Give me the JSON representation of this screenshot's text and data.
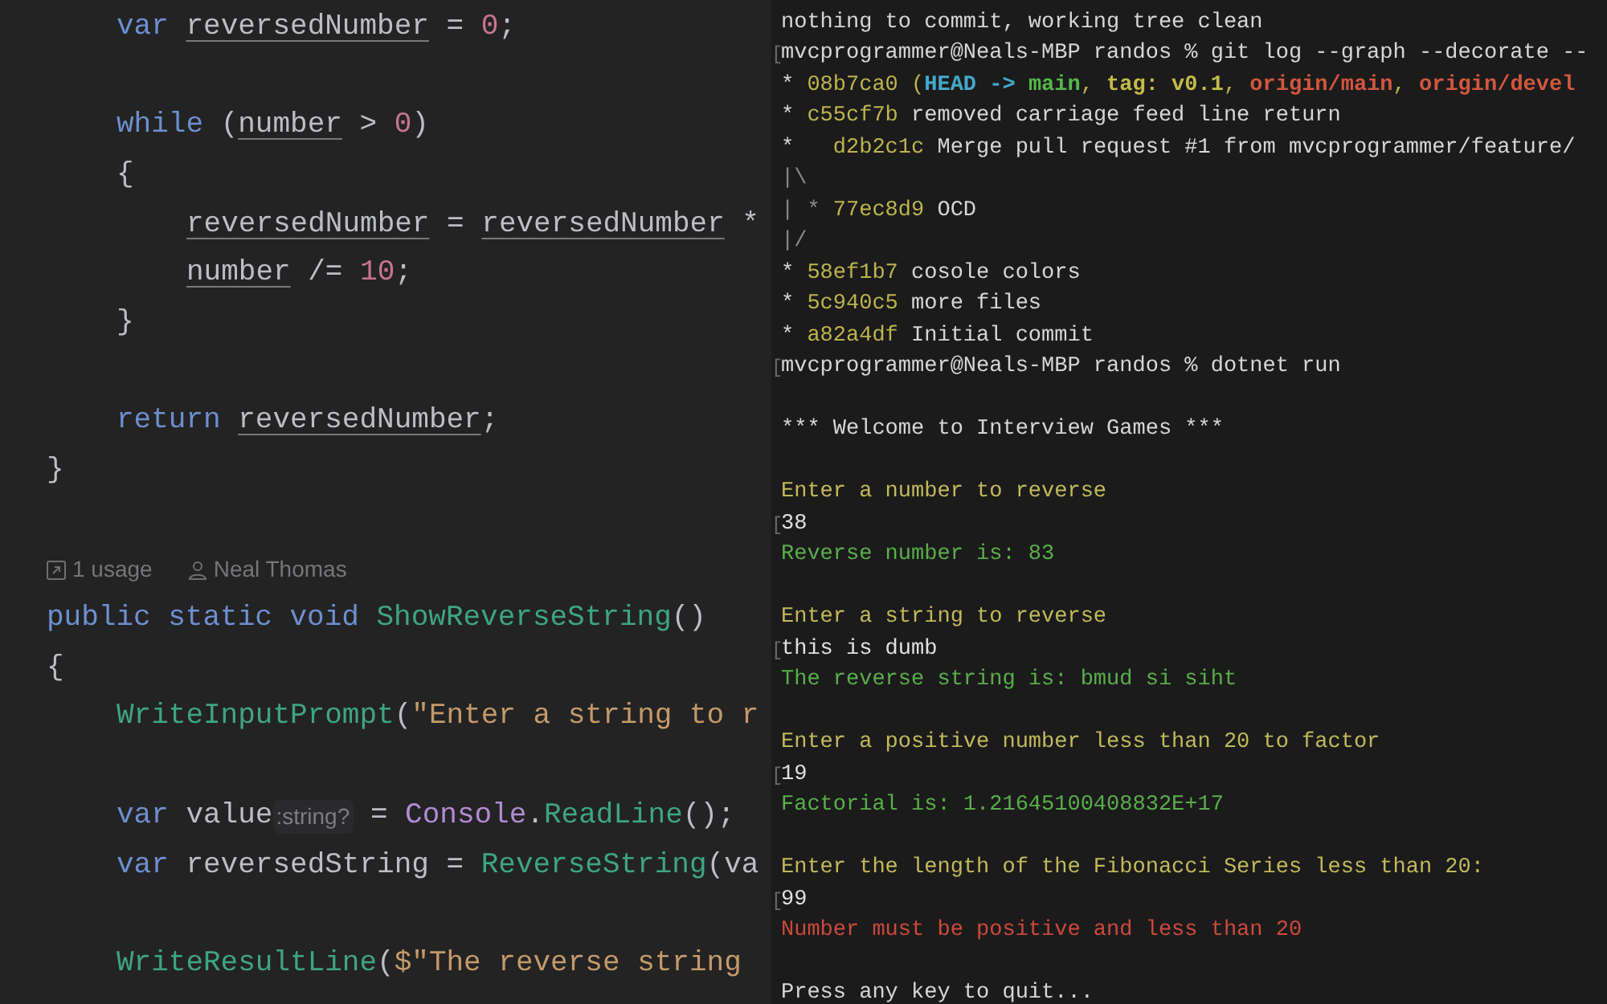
{
  "editor": {
    "lines": [
      {
        "kind": "group",
        "children": [
          {
            "kind": "code",
            "tokens": [
              {
                "kind": "keyword",
                "text": "var "
              },
              {
                "kind": "local",
                "text": "reversedNumber"
              },
              {
                "kind": "plain",
                "text": " = "
              },
              {
                "kind": "number",
                "text": "0"
              },
              {
                "kind": "plain",
                "text": ";"
              }
            ]
          },
          {
            "kind": "blank"
          },
          {
            "kind": "code",
            "tokens": [
              {
                "kind": "keyword",
                "text": "while"
              },
              {
                "kind": "plain",
                "text": " ("
              },
              {
                "kind": "local",
                "text": "number"
              },
              {
                "kind": "plain",
                "text": " > "
              },
              {
                "kind": "number",
                "text": "0"
              },
              {
                "kind": "plain",
                "text": ")"
              }
            ]
          },
          {
            "kind": "code",
            "tokens": [
              {
                "kind": "plain",
                "text": "{"
              }
            ],
            "children": [
              {
                "kind": "code",
                "tokens": [
                  {
                    "kind": "local",
                    "text": "reversedNumber"
                  },
                  {
                    "kind": "plain",
                    "text": " = "
                  },
                  {
                    "kind": "local",
                    "text": "reversedNumber"
                  },
                  {
                    "kind": "plain",
                    "text": " *"
                  }
                ]
              },
              {
                "kind": "code",
                "tokens": [
                  {
                    "kind": "local",
                    "text": "number"
                  },
                  {
                    "kind": "plain",
                    "text": " /= "
                  },
                  {
                    "kind": "number",
                    "text": "10"
                  },
                  {
                    "kind": "plain",
                    "text": ";"
                  }
                ]
              }
            ]
          },
          {
            "kind": "code",
            "tokens": [
              {
                "kind": "plain",
                "text": "}"
              }
            ]
          },
          {
            "kind": "blank"
          },
          {
            "kind": "code",
            "tokens": [
              {
                "kind": "keyword",
                "text": "return "
              },
              {
                "kind": "local",
                "text": "reversedNumber"
              },
              {
                "kind": "plain",
                "text": ";"
              }
            ]
          }
        ]
      },
      {
        "kind": "code",
        "tokens": [
          {
            "kind": "plain",
            "text": "}"
          }
        ]
      },
      {
        "kind": "blank"
      },
      {
        "kind": "lens",
        "usages": "1 usage",
        "author": "Neal Thomas"
      },
      {
        "kind": "code",
        "tokens": [
          {
            "kind": "keyword",
            "text": "public static void "
          },
          {
            "kind": "func",
            "text": "ShowReverseString"
          },
          {
            "kind": "plain",
            "text": "()"
          }
        ]
      },
      {
        "kind": "code",
        "tokens": [
          {
            "kind": "plain",
            "text": "{"
          }
        ],
        "children": [
          {
            "kind": "code",
            "tokens": [
              {
                "kind": "func",
                "text": "WriteInputPrompt"
              },
              {
                "kind": "plain",
                "text": "("
              },
              {
                "kind": "string",
                "text": "\"Enter a string to r"
              }
            ]
          },
          {
            "kind": "blank"
          },
          {
            "kind": "code",
            "tokens": [
              {
                "kind": "keyword",
                "text": "var"
              },
              {
                "kind": "plain",
                "text": " value"
              },
              {
                "kind": "hint",
                "text": ":string?"
              },
              {
                "kind": "plain",
                "text": " = "
              },
              {
                "kind": "class",
                "text": "Console"
              },
              {
                "kind": "plain",
                "text": "."
              },
              {
                "kind": "func",
                "text": "ReadLine"
              },
              {
                "kind": "plain",
                "text": "();"
              }
            ]
          },
          {
            "kind": "code",
            "tokens": [
              {
                "kind": "keyword",
                "text": "var"
              },
              {
                "kind": "plain",
                "text": " reversedString = "
              },
              {
                "kind": "func",
                "text": "ReverseString"
              },
              {
                "kind": "plain",
                "text": "(va"
              }
            ]
          },
          {
            "kind": "blank"
          },
          {
            "kind": "code",
            "tokens": [
              {
                "kind": "func",
                "text": "WriteResultLine"
              },
              {
                "kind": "plain",
                "text": "("
              },
              {
                "kind": "string",
                "text": "$\"The reverse string"
              }
            ]
          }
        ]
      }
    ]
  },
  "terminal": {
    "lines": [
      {
        "kind": "text",
        "segments": [
          {
            "text": "nothing to commit, working tree clean",
            "color": "#d6d6d6"
          }
        ]
      },
      {
        "kind": "text",
        "mark": "[",
        "segments": [
          {
            "text": "mvcprogrammer@Neals-MBP randos % git log --graph --decorate --",
            "color": "#d6d6d6"
          }
        ]
      },
      {
        "kind": "text",
        "segments": [
          {
            "text": "* ",
            "color": "#d6d6d6"
          },
          {
            "text": "08b7ca0 (",
            "color": "#bdb44c"
          },
          {
            "text": "HEAD -> ",
            "color": "#45a8cc",
            "bold": true
          },
          {
            "text": "main",
            "color": "#55b849",
            "bold": true
          },
          {
            "text": ", ",
            "color": "#bdb44c"
          },
          {
            "text": "tag: v0.1",
            "color": "#c6bb4a",
            "bold": true
          },
          {
            "text": ", ",
            "color": "#bdb44c"
          },
          {
            "text": "origin/main",
            "color": "#d2573f",
            "bold": true
          },
          {
            "text": ", ",
            "color": "#bdb44c"
          },
          {
            "text": "origin/devel",
            "color": "#d2573f",
            "bold": true
          }
        ]
      },
      {
        "kind": "text",
        "segments": [
          {
            "text": "* ",
            "color": "#d6d6d6"
          },
          {
            "text": "c55cf7b",
            "color": "#bdb44c"
          },
          {
            "text": " removed carriage feed line return",
            "color": "#d6d6d6"
          }
        ]
      },
      {
        "kind": "text",
        "segments": [
          {
            "text": "*   ",
            "color": "#d6d6d6"
          },
          {
            "text": "d2b2c1c",
            "color": "#bdb44c"
          },
          {
            "text": " Merge pull request #1 from mvcprogrammer/feature/",
            "color": "#d6d6d6"
          }
        ]
      },
      {
        "kind": "text",
        "segments": [
          {
            "text": "|\\",
            "color": "#8a8a8a"
          }
        ]
      },
      {
        "kind": "text",
        "segments": [
          {
            "text": "| * ",
            "color": "#8a8a8a"
          },
          {
            "text": "77ec8d9",
            "color": "#bdb44c"
          },
          {
            "text": " OCD",
            "color": "#d6d6d6"
          }
        ]
      },
      {
        "kind": "text",
        "segments": [
          {
            "text": "|/",
            "color": "#8a8a8a"
          }
        ]
      },
      {
        "kind": "text",
        "segments": [
          {
            "text": "* ",
            "color": "#d6d6d6"
          },
          {
            "text": "58ef1b7",
            "color": "#bdb44c"
          },
          {
            "text": " cosole colors",
            "color": "#d6d6d6"
          }
        ]
      },
      {
        "kind": "text",
        "segments": [
          {
            "text": "* ",
            "color": "#d6d6d6"
          },
          {
            "text": "5c940c5",
            "color": "#bdb44c"
          },
          {
            "text": " more files",
            "color": "#d6d6d6"
          }
        ]
      },
      {
        "kind": "text",
        "segments": [
          {
            "text": "* ",
            "color": "#d6d6d6"
          },
          {
            "text": "a82a4df",
            "color": "#bdb44c"
          },
          {
            "text": " Initial commit",
            "color": "#d6d6d6"
          }
        ]
      },
      {
        "kind": "text",
        "mark": "[",
        "segments": [
          {
            "text": "mvcprogrammer@Neals-MBP randos % dotnet run",
            "color": "#d6d6d6"
          }
        ]
      },
      {
        "kind": "blank"
      },
      {
        "kind": "text",
        "segments": [
          {
            "text": "*** Welcome to Interview Games ***",
            "color": "#d6d6d6"
          }
        ]
      },
      {
        "kind": "blank"
      },
      {
        "kind": "text",
        "segments": [
          {
            "text": "Enter a number to reverse",
            "color": "#c2b95a"
          }
        ]
      },
      {
        "kind": "text",
        "mark": "[",
        "segments": [
          {
            "text": "38",
            "color": "#e0e0e0"
          }
        ]
      },
      {
        "kind": "text",
        "segments": [
          {
            "text": "Reverse number is: 83",
            "color": "#5aae4a"
          }
        ]
      },
      {
        "kind": "blank"
      },
      {
        "kind": "text",
        "segments": [
          {
            "text": "Enter a string to reverse",
            "color": "#c2b95a"
          }
        ]
      },
      {
        "kind": "text",
        "mark": "[",
        "segments": [
          {
            "text": "this is dumb",
            "color": "#e0e0e0"
          }
        ]
      },
      {
        "kind": "text",
        "segments": [
          {
            "text": "The reverse string is: bmud si siht",
            "color": "#5aae4a"
          }
        ]
      },
      {
        "kind": "blank"
      },
      {
        "kind": "text",
        "segments": [
          {
            "text": "Enter a positive number less than 20 to factor",
            "color": "#c2b95a"
          }
        ]
      },
      {
        "kind": "text",
        "mark": "[",
        "segments": [
          {
            "text": "19",
            "color": "#e0e0e0"
          }
        ]
      },
      {
        "kind": "text",
        "segments": [
          {
            "text": "Factorial is: 1.21645100408832E+17",
            "color": "#5aae4a"
          }
        ]
      },
      {
        "kind": "blank"
      },
      {
        "kind": "text",
        "segments": [
          {
            "text": "Enter the length of the Fibonacci Series less than 20:",
            "color": "#c2b95a"
          }
        ]
      },
      {
        "kind": "text",
        "mark": "[",
        "segments": [
          {
            "text": "99",
            "color": "#e0e0e0"
          }
        ]
      },
      {
        "kind": "text",
        "segments": [
          {
            "text": "Number must be positive and less than 20",
            "color": "#cc4a3c"
          }
        ]
      },
      {
        "kind": "blank"
      },
      {
        "kind": "text",
        "segments": [
          {
            "text": "Press any key to quit...",
            "color": "#d6d6d6"
          }
        ]
      }
    ]
  }
}
